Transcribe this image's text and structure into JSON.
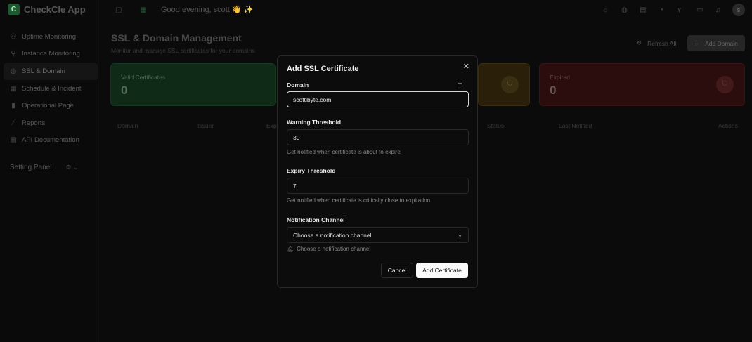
{
  "app": {
    "logo_letter": "C",
    "name": "CheckCle App"
  },
  "sidebar": {
    "items": [
      {
        "label": "Uptime Monitoring",
        "icon": "network-icon"
      },
      {
        "label": "Instance Monitoring",
        "icon": "server-icon"
      },
      {
        "label": "SSL & Domain",
        "icon": "globe-icon"
      },
      {
        "label": "Schedule & Incident",
        "icon": "calendar-icon"
      },
      {
        "label": "Operational Page",
        "icon": "bar-chart-icon"
      },
      {
        "label": "Reports",
        "icon": "line-chart-icon"
      },
      {
        "label": "API Documentation",
        "icon": "file-icon"
      }
    ],
    "setting_panel": "Setting Panel"
  },
  "topbar": {
    "greeting": "Good evening, scott 👋 ✨",
    "avatar": "s"
  },
  "page": {
    "title": "SSL & Domain Management",
    "subtitle": "Monitor and manage SSL certificates for your domains",
    "refresh_label": "Refresh All",
    "add_label": "Add Domain"
  },
  "cards": {
    "valid": {
      "label": "Valid Certificates",
      "value": "0"
    },
    "expired": {
      "label": "Expired",
      "value": "0"
    }
  },
  "table": {
    "headers": [
      "Domain",
      "Issuer",
      "Expi",
      "Status",
      "Last Notified",
      "Actions"
    ]
  },
  "modal": {
    "title": "Add SSL Certificate",
    "domain_label": "Domain",
    "domain_value": "scottibyte.com",
    "warning_label": "Warning Threshold",
    "warning_value": "30",
    "warning_help": "Get notified when certificate is about to expire",
    "expiry_label": "Expiry Threshold",
    "expiry_value": "7",
    "expiry_help": "Get notified when certificate is critically close to expiration",
    "channel_label": "Notification Channel",
    "channel_value": "Choose a notification channel",
    "channel_hint": "Choose a notification channel",
    "cancel_label": "Cancel",
    "submit_label": "Add Certificate"
  },
  "colors": {
    "accent_green": "#1a5c30",
    "primary_button": "#fafafa"
  }
}
